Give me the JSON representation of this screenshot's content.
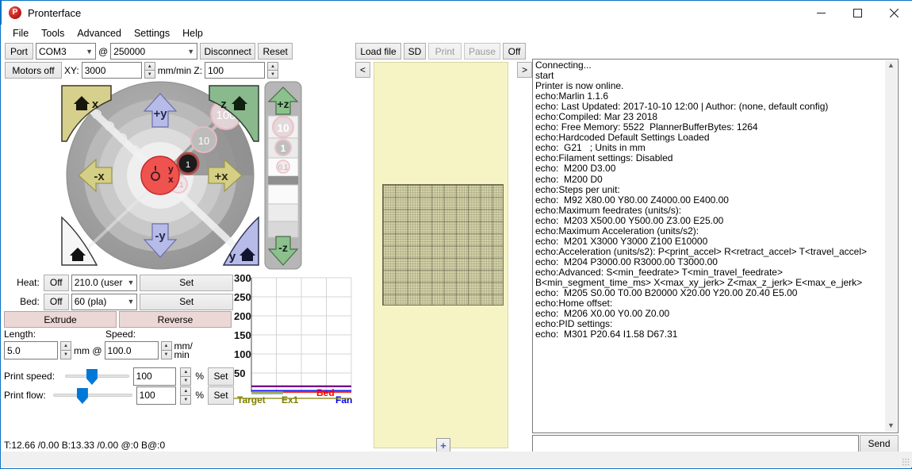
{
  "window": {
    "title": "Pronterface",
    "icon": "pronterface-logo-icon",
    "minimize": "—",
    "maximize": "☐",
    "close": "✕"
  },
  "menubar": {
    "items": [
      {
        "label": "File"
      },
      {
        "label": "Tools"
      },
      {
        "label": "Advanced"
      },
      {
        "label": "Settings"
      },
      {
        "label": "Help"
      }
    ]
  },
  "connection": {
    "port_label": "Port",
    "port_value": "COM3",
    "at_symbol": "@",
    "baud_value": "250000",
    "disconnect_label": "Disconnect",
    "reset_label": "Reset"
  },
  "motion": {
    "motors_off_label": "Motors off",
    "xy_label": "XY:",
    "xy_value": "3000",
    "units_label": "mm/min",
    "z_label": "Z:",
    "z_value": "100"
  },
  "jog": {
    "home_x": "x",
    "home_z": "z",
    "home_all": "home",
    "home_y": "y",
    "plus_y": "+y",
    "minus_y": "-y",
    "plus_x": "+x",
    "minus_x": "-x",
    "center_label_y": "y",
    "center_label_x": "x",
    "ring_labels": [
      "0.1",
      "1",
      "10",
      "100"
    ],
    "selected_ring": "1",
    "z_plus": "+z",
    "z_minus": "-z",
    "z_steps": [
      "10",
      "1",
      "0.1"
    ]
  },
  "heat": {
    "extruder_label": "Heat:",
    "extruder_off": "Off",
    "extruder_target": "210.0 (user",
    "extruder_set": "Set",
    "bed_label": "Bed:",
    "bed_off": "Off",
    "bed_target": "60 (pla)",
    "bed_set": "Set"
  },
  "extrusion": {
    "extrude_label": "Extrude",
    "reverse_label": "Reverse",
    "length_label": "Length:",
    "length_value": "5.0",
    "mm_at_label": "mm @",
    "speed_label": "Speed:",
    "speed_value": "100.0",
    "speed_units": "mm/\nmin"
  },
  "sliders": {
    "print_speed_label": "Print speed:",
    "print_speed_value": "100",
    "print_speed_percent": "%",
    "print_speed_set": "Set",
    "print_flow_label": "Print flow:",
    "print_flow_value": "100",
    "print_flow_percent": "%",
    "print_flow_set": "Set"
  },
  "status": {
    "line": "T:12.66 /0.00 B:13.33 /0.00 @:0 B@:0"
  },
  "chart_data": {
    "type": "line",
    "title": "",
    "xlabel": "",
    "ylabel": "",
    "ylim": [
      0,
      300
    ],
    "yticks": [
      50,
      100,
      150,
      200,
      250,
      300
    ],
    "grid": true,
    "legend_position": "bottom",
    "legend": [
      {
        "name": "Target",
        "color": "#808000"
      },
      {
        "name": "Ex1",
        "color": "#808000"
      },
      {
        "name": "Bed",
        "color": "#ff0000"
      },
      {
        "name": "Fan",
        "color": "#0000ff"
      }
    ],
    "series": [
      {
        "name": "Target",
        "color": "#808000",
        "values": [
          0,
          0,
          0,
          0,
          0,
          0
        ]
      },
      {
        "name": "Ex1",
        "color": "#ff0000",
        "values": [
          12.66,
          12.66,
          12.66,
          12.66,
          12.66,
          12.66
        ]
      },
      {
        "name": "Bed",
        "color": "#0000ff",
        "values": [
          13.33,
          13.33,
          13.33,
          13.33,
          13.33,
          13.33
        ]
      },
      {
        "name": "Fan",
        "color": "#0000ff",
        "values": [
          0,
          0,
          0,
          0,
          0,
          0
        ]
      }
    ]
  },
  "print_toolbar": {
    "load_file": "Load file",
    "sd": "SD",
    "print": "Print",
    "pause": "Pause",
    "off": "Off",
    "print_disabled": true,
    "pause_disabled": true
  },
  "panes": {
    "collapse_left": "<",
    "collapse_right": ">",
    "add_button": "+"
  },
  "console": {
    "lines": [
      "Connecting...",
      "start",
      "Printer is now online.",
      "echo:Marlin 1.1.6",
      "echo: Last Updated: 2017-10-10 12:00 | Author: (none, default config)",
      "echo:Compiled: Mar 23 2018",
      "echo: Free Memory: 5522  PlannerBufferBytes: 1264",
      "echo:Hardcoded Default Settings Loaded",
      "echo:  G21   ; Units in mm",
      "echo:Filament settings: Disabled",
      "echo:  M200 D3.00",
      "echo:  M200 D0",
      "echo:Steps per unit:",
      "echo:  M92 X80.00 Y80.00 Z4000.00 E400.00",
      "echo:Maximum feedrates (units/s):",
      "echo:  M203 X500.00 Y500.00 Z3.00 E25.00",
      "echo:Maximum Acceleration (units/s2):",
      "echo:  M201 X3000 Y3000 Z100 E10000",
      "echo:Acceleration (units/s2): P<print_accel> R<retract_accel> T<travel_accel>",
      "echo:  M204 P3000.00 R3000.00 T3000.00",
      "echo:Advanced: S<min_feedrate> T<min_travel_feedrate> B<min_segment_time_ms> X<max_xy_jerk> Z<max_z_jerk> E<max_e_jerk>",
      "echo:  M205 S0.00 T0.00 B20000 X20.00 Y20.00 Z0.40 E5.00",
      "echo:Home offset:",
      "echo:  M206 X0.00 Y0.00 Z0.00",
      "echo:PID settings:",
      "echo:  M301 P20.64 I1.58 D67.31"
    ]
  },
  "command": {
    "value": "",
    "placeholder": "",
    "send_label": "Send"
  },
  "colors": {
    "accent": "#0a72c4",
    "bed": "#f6f4c5",
    "extrude_button": "#ecd7d7",
    "x_axis": "#cdc77e",
    "y_axis": "#a8acde",
    "z_axis": "#86b786",
    "center": "#ef5350"
  }
}
